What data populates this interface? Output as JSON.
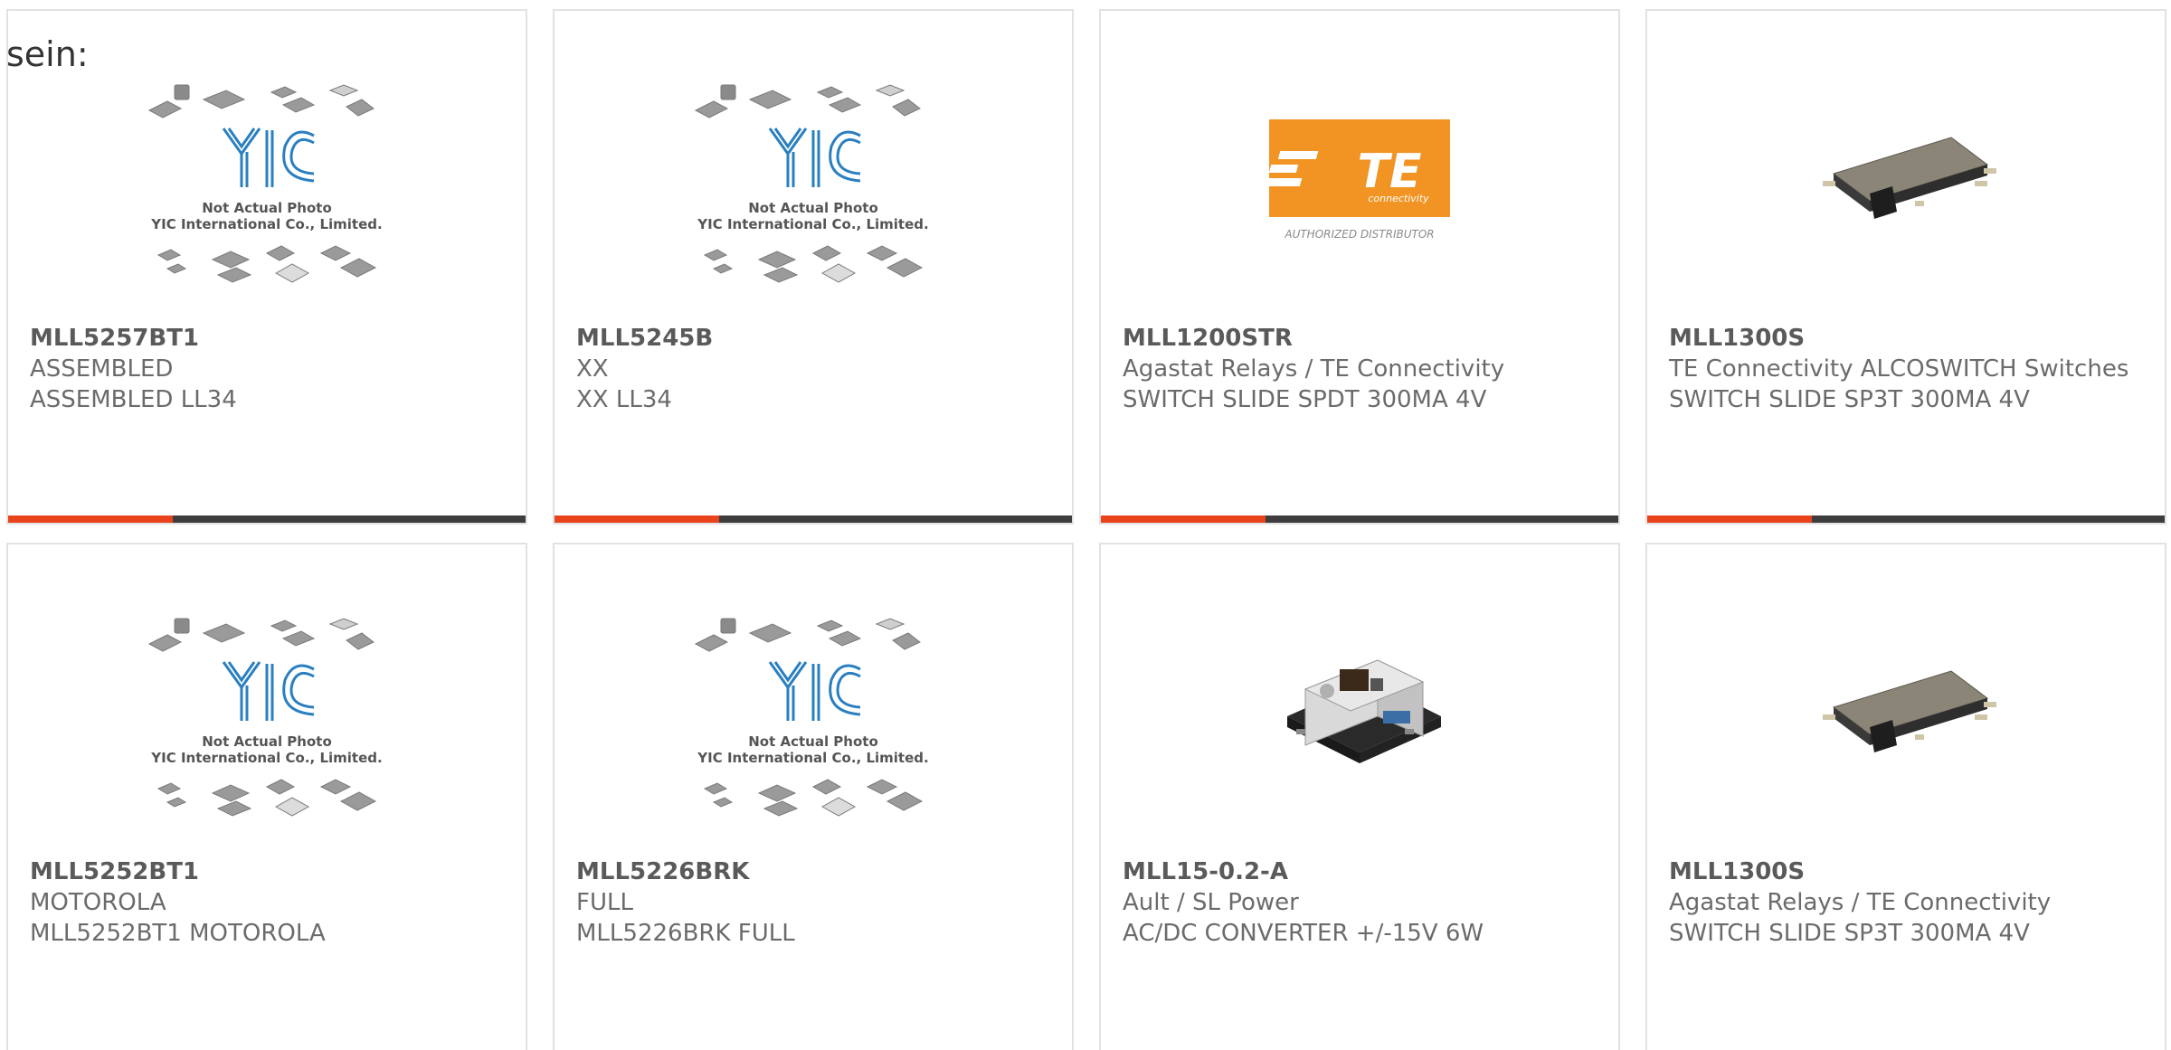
{
  "intro": "sein:",
  "placeholder": {
    "brand": "YIC",
    "line1": "Not Actual Photo",
    "line2": "YIC International Co., Limited."
  },
  "te_logo": {
    "text": "TE",
    "sub": "connectivity",
    "caption": "AUTHORIZED DISTRIBUTOR"
  },
  "colors": {
    "accent": "#e8431b",
    "bar": "#3d3d3d",
    "te_orange": "#f29423",
    "yic_blue": "#2a7fc0"
  },
  "products": [
    {
      "part": "MLL5257BT1",
      "maker": "ASSEMBLED",
      "desc": "ASSEMBLED LL34",
      "image": "yic-placeholder"
    },
    {
      "part": "MLL5245B",
      "maker": "XX",
      "desc": "XX LL34",
      "image": "yic-placeholder"
    },
    {
      "part": "MLL1200STR",
      "maker": "Agastat Relays / TE Connectivity",
      "desc": "SWITCH SLIDE SPDT 300MA 4V",
      "image": "te-logo"
    },
    {
      "part": "MLL1300S",
      "maker": "TE Connectivity ALCOSWITCH Switches",
      "desc": "SWITCH SLIDE SP3T 300MA 4V",
      "image": "slide-switch"
    },
    {
      "part": "MLL5252BT1",
      "maker": "MOTOROLA",
      "desc": "MLL5252BT1 MOTOROLA",
      "image": "yic-placeholder"
    },
    {
      "part": "MLL5226BRK",
      "maker": "FULL",
      "desc": "MLL5226BRK FULL",
      "image": "yic-placeholder"
    },
    {
      "part": "MLL15-0.2-A",
      "maker": "Ault / SL Power",
      "desc": "AC/DC CONVERTER +/-15V 6W",
      "image": "power-module"
    },
    {
      "part": "MLL1300S",
      "maker": "Agastat Relays / TE Connectivity",
      "desc": "SWITCH SLIDE SP3T 300MA 4V",
      "image": "slide-switch"
    }
  ]
}
